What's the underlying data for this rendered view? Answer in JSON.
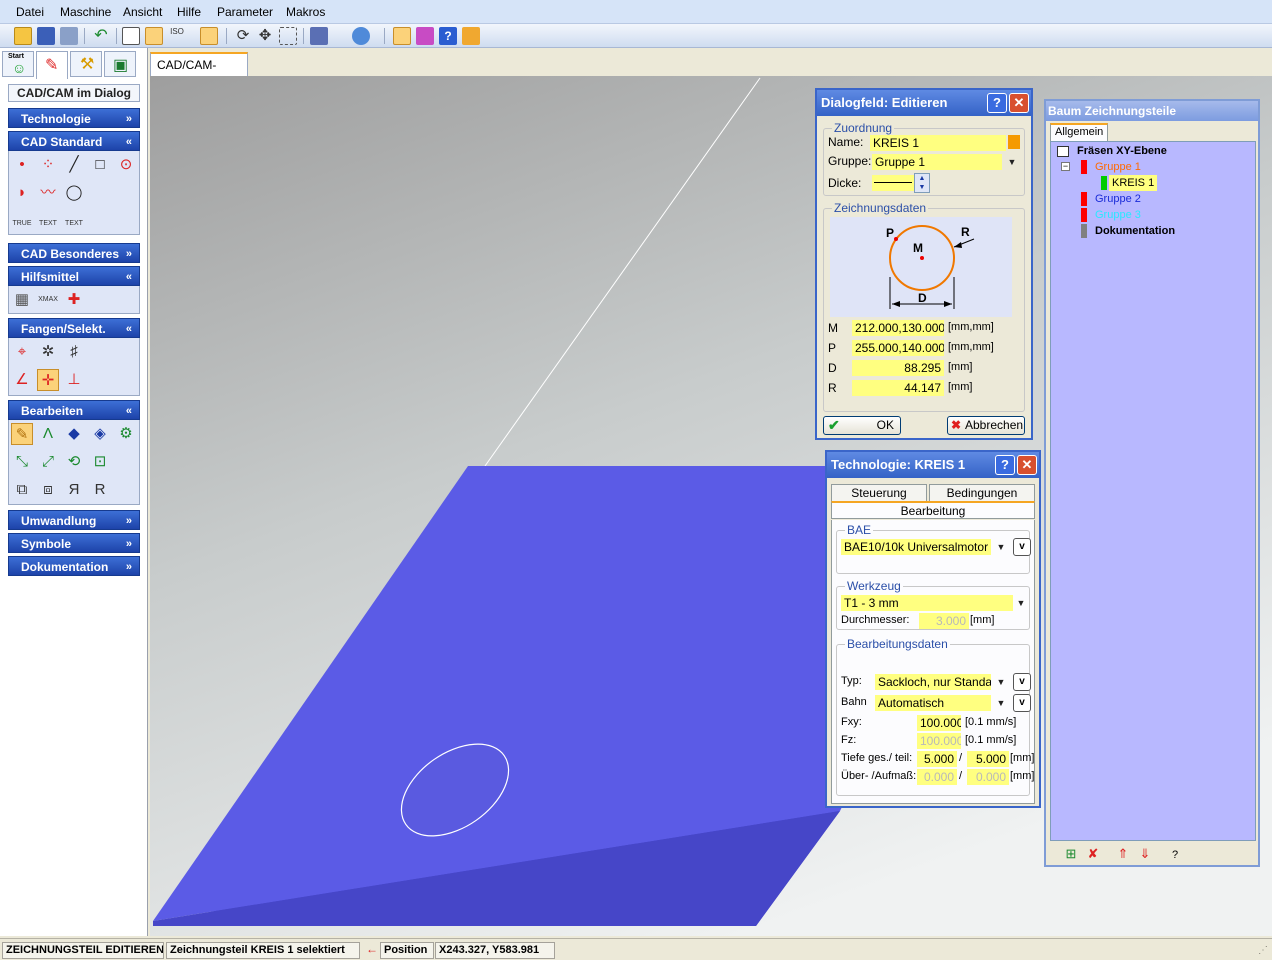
{
  "menu": [
    "Datei",
    "Maschine",
    "Ansicht",
    "Hilfe",
    "Parameter",
    "Makros"
  ],
  "left_panel": {
    "start_tab_label": "Start",
    "header": "CAD/CAM im Dialog",
    "groups": {
      "technologie": "Technologie",
      "cad_standard": "CAD Standard",
      "cad_besonderes": "CAD Besonderes",
      "hilfsmittel": "Hilfsmittel",
      "fangen": "Fangen/Selekt.",
      "bearbeiten": "Bearbeiten",
      "umwandlung": "Umwandlung",
      "symbole": "Symbole",
      "dokumentation": "Dokumentation"
    },
    "text_icons": [
      "TRUE",
      "TEXT",
      "TEXT"
    ],
    "xmax_icon": "XMAX",
    "chevron_down": "»",
    "chevron_up": "«"
  },
  "document_tab": "CAD/CAM-Fräsen",
  "edit_dialog": {
    "title": "Dialogfeld: Editieren",
    "help": "?",
    "close": "✕",
    "zuordnung_legend": "Zuordnung",
    "name_label": "Name:",
    "name_value": "KREIS 1",
    "gruppe_label": "Gruppe:",
    "gruppe_value": "Gruppe 1",
    "dicke_label": "Dicke:",
    "zeichnungsdaten_legend": "Zeichnungsdaten",
    "diagram_labels": {
      "p": "P",
      "m": "M",
      "r": "R",
      "d": "D"
    },
    "rows": [
      {
        "label": "M",
        "value": "212.000,130.000",
        "unit": "[mm,mm]"
      },
      {
        "label": "P",
        "value": "255.000,140.000",
        "unit": "[mm,mm]"
      },
      {
        "label": "D",
        "value": "88.295",
        "unit": "[mm]"
      },
      {
        "label": "R",
        "value": "44.147",
        "unit": "[mm]"
      }
    ],
    "ok_label": "OK",
    "cancel_label": "Abbrechen"
  },
  "tech_dialog": {
    "title": "Technologie:  KREIS 1",
    "help": "?",
    "close": "✕",
    "tabs": [
      "Steuerung",
      "Bedingungen",
      "Bearbeitung"
    ],
    "bae_legend": "BAE",
    "bae_value": "BAE10/10k Universalmotor",
    "werkzeug_legend": "Werkzeug",
    "werkzeug_value": "T1 - 3 mm",
    "durchmesser_label": "Durchmesser:",
    "durchmesser_value": "3.000",
    "durchmesser_unit": "[mm]",
    "bearbeitungsdaten_legend": "Bearbeitungsdaten",
    "typ_label": "Typ:",
    "typ_value": "Sackloch, nur Standarc",
    "bahn_label": "Bahn",
    "bahn_value": "Automatisch",
    "fxy_label": "Fxy:",
    "fxy_value": "100.000",
    "fxy_unit": "[0.1 mm/s]",
    "fz_label": "Fz:",
    "fz_value": "100.000",
    "fz_unit": "[0.1 mm/s]",
    "tiefe_label": "Tiefe ges./ teil:",
    "tiefe_value1": "5.000",
    "tiefe_value2": "5.000",
    "tiefe_unit": "[mm]",
    "ueber_label": "Über- /Aufmaß:",
    "ueber_value1": "0.000",
    "ueber_value2": "0.000",
    "ueber_unit": "[mm]",
    "slash": "/",
    "v": "v"
  },
  "tree": {
    "title": "Baum Zeichnungsteile",
    "tab": "Allgemein",
    "root": "Fräsen XY-Ebene",
    "minus": "−",
    "nodes": [
      {
        "label": "Gruppe 1",
        "color": "#ff6a00",
        "mark": "#ff0000"
      },
      {
        "label": "KREIS 1",
        "color": "#000000",
        "mark": "#00cc00"
      },
      {
        "label": "Gruppe 2",
        "color": "#1a2bd8",
        "mark": "#ff0000"
      },
      {
        "label": "Gruppe 3",
        "color": "#29e8ff",
        "mark": "#ff0000"
      },
      {
        "label": "Dokumentation",
        "color": "#000000",
        "mark": "#808080"
      }
    ],
    "footer_help": "?"
  },
  "status": {
    "mode": "ZEICHNUNGSTEIL EDITIEREN",
    "message": "Zeichnungsteil KREIS 1 selektiert",
    "arrow": "←",
    "position_label": "Position",
    "position_value": "X243.327, Y583.981"
  },
  "colors": {
    "plate": "#5b5be6",
    "plate_edge": "#4646c8",
    "field": "#ffff80",
    "titlebar": "#3462c6"
  }
}
